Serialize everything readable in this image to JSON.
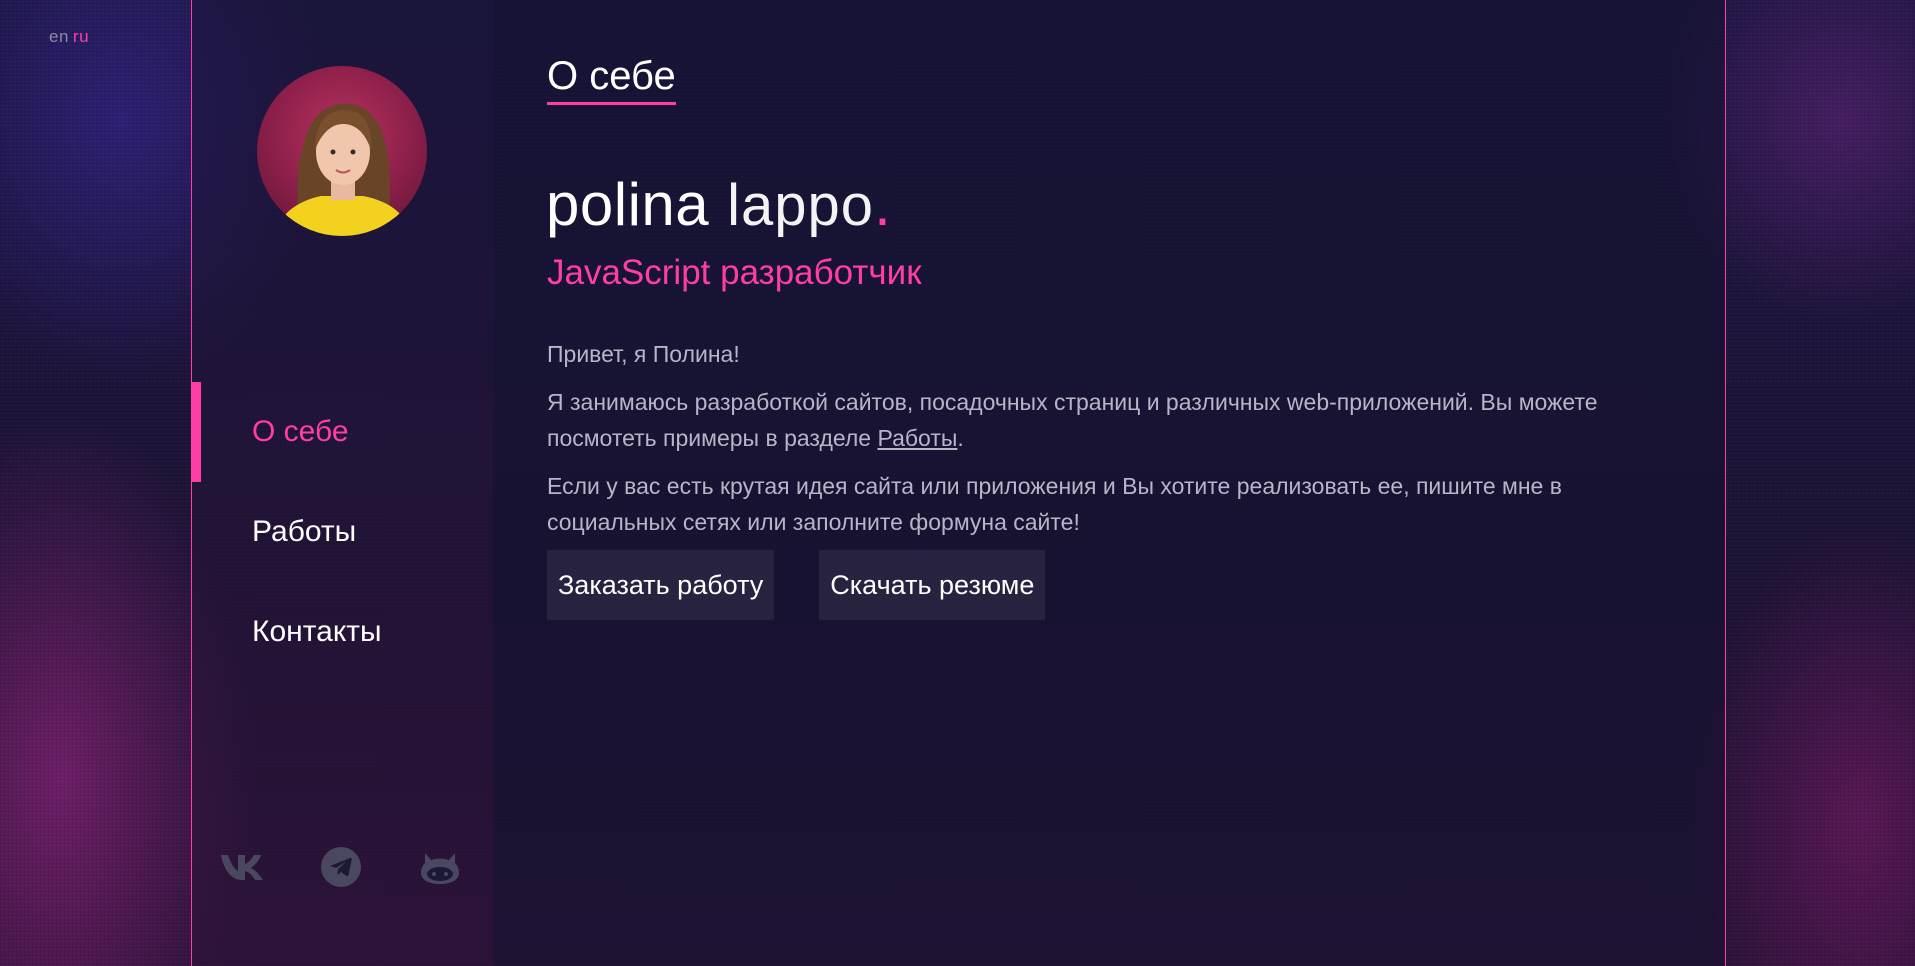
{
  "lang": {
    "en": "en",
    "ru": "ru",
    "active": "ru"
  },
  "colors": {
    "accent": "#ff3ea5",
    "text": "#ffffff",
    "muted": "#b7b5c8"
  },
  "sidebar": {
    "avatar_icon": "profile-photo",
    "nav": [
      {
        "label": "О себе",
        "active": true
      },
      {
        "label": "Работы",
        "active": false
      },
      {
        "label": "Контакты",
        "active": false
      }
    ],
    "social": [
      {
        "icon": "vk-icon"
      },
      {
        "icon": "telegram-icon"
      },
      {
        "icon": "github-icon"
      }
    ]
  },
  "main": {
    "title": "О себе",
    "brand": {
      "first": "polina",
      "last": "lappo",
      "dot": "."
    },
    "role": "JavaScript разработчик",
    "greeting": "Привет, я Полина!",
    "paragraph1_prefix": "Я занимаюсь разработкой сайтов, посадочных страниц и различных web-приложений. Вы можете посмотеть примеры в разделе ",
    "paragraph1_link": "Работы",
    "paragraph1_suffix": ".",
    "paragraph2": "Если у вас есть крутая идея сайта или приложения и Вы хотите реализовать ее, пишите мне в социальных сетях или заполните формуна сайте!",
    "buttons": {
      "order": "Заказать работу",
      "resume": "Скачать резюме"
    }
  }
}
